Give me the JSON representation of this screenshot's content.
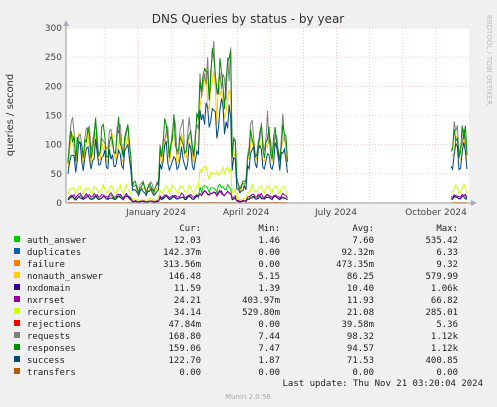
{
  "chart_data": {
    "type": "line",
    "title": "DNS Queries by status - by year",
    "ylabel": "queries / second",
    "side_label": "RRDTOOL / TOBI OETIKER",
    "ylim": [
      0,
      300
    ],
    "yticks": [
      0,
      50,
      100,
      150,
      200,
      250,
      300
    ],
    "x_tick_labels": [
      "January 2024",
      "April 2024",
      "July 2024",
      "October 2024"
    ],
    "grid": true,
    "legend_headers": {
      "cur": "Cur:",
      "min": "Min:",
      "avg": "Avg:",
      "max": "Max:"
    },
    "legend": [
      {
        "name": "auth_answer",
        "color": "#00cc00",
        "cur": "12.03",
        "min": "1.46",
        "avg": "7.60",
        "max": "535.42"
      },
      {
        "name": "duplicates",
        "color": "#0066b3",
        "cur": "142.37m",
        "min": "0.00",
        "avg": "92.32m",
        "max": "6.33"
      },
      {
        "name": "failure",
        "color": "#ff8000",
        "cur": "313.56m",
        "min": "0.00",
        "avg": "473.35m",
        "max": "9.32"
      },
      {
        "name": "nonauth_answer",
        "color": "#ffcc00",
        "cur": "146.48",
        "min": "5.15",
        "avg": "86.25",
        "max": "579.99"
      },
      {
        "name": "nxdomain",
        "color": "#330099",
        "cur": "11.59",
        "min": "1.39",
        "avg": "10.40",
        "max": "1.06k"
      },
      {
        "name": "nxrrset",
        "color": "#990099",
        "cur": "24.21",
        "min": "403.97m",
        "avg": "11.93",
        "max": "66.82"
      },
      {
        "name": "recursion",
        "color": "#ccff00",
        "cur": "34.14",
        "min": "529.80m",
        "avg": "21.08",
        "max": "285.01"
      },
      {
        "name": "rejections",
        "color": "#ff0000",
        "cur": "47.84m",
        "min": "0.00",
        "avg": "39.58m",
        "max": "5.36"
      },
      {
        "name": "requests",
        "color": "#808080",
        "cur": "168.80",
        "min": "7.44",
        "avg": "98.32",
        "max": "1.12k"
      },
      {
        "name": "responses",
        "color": "#008f00",
        "cur": "159.06",
        "min": "7.47",
        "avg": "94.57",
        "max": "1.12k"
      },
      {
        "name": "success",
        "color": "#00487d",
        "cur": "122.70",
        "min": "1.87",
        "avg": "71.53",
        "max": "400.85"
      },
      {
        "name": "transfers",
        "color": "#b35a00",
        "cur": "0.00",
        "min": "0.00",
        "avg": "0.00",
        "max": "0.00"
      }
    ]
  },
  "footer": {
    "last_update": "Last update: Thu Nov 21 03:20:04 2024",
    "version": "Munin 2.0.56"
  }
}
